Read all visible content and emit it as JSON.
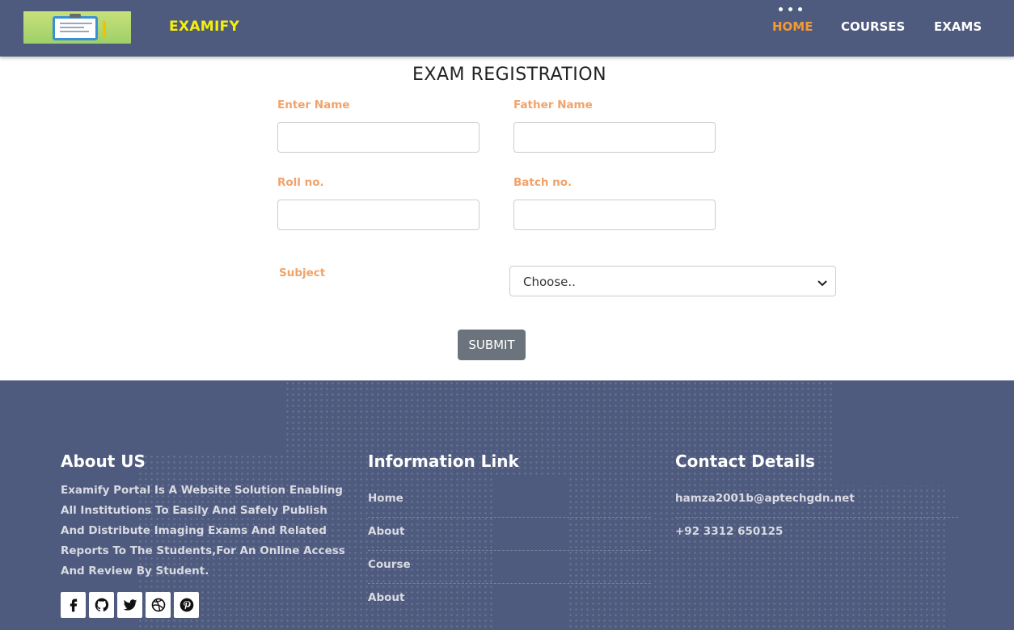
{
  "navbar": {
    "brand": "EXAMIFY",
    "links": [
      {
        "label": "HOME",
        "active": true
      },
      {
        "label": "COURSES",
        "active": false
      },
      {
        "label": "EXAMS",
        "active": false
      }
    ]
  },
  "form": {
    "title": "EXAM REGISTRATION",
    "name_label": "Enter Name",
    "name_value": "",
    "father_label": "Father Name",
    "father_value": "",
    "roll_label": "Roll no.",
    "roll_value": "",
    "batch_label": "Batch no.",
    "batch_value": "",
    "subject_label": "Subject",
    "subject_selected": "Choose..",
    "submit_label": "SUBMIT"
  },
  "footer": {
    "about_heading": "About US",
    "about_text": "Examify Portal Is A Website Solution Enabling All Institutions To Easily And Safely Publish And Distribute Imaging Exams And Related Reports To The Students,For An Online Access And Review By Student.",
    "social_icons": [
      "facebook-icon",
      "github-icon",
      "twitter-icon",
      "dribbble-icon",
      "pinterest-icon"
    ],
    "info_heading": "Information Link",
    "info_links": [
      "Home",
      "About",
      "Course",
      "About"
    ],
    "contact_heading": "Contact Details",
    "contact_email": "hamza2001b@aptechgdn.net",
    "contact_phone": "+92 3312 650125"
  },
  "colors": {
    "navbar_bg": "#4e5a7e",
    "brand": "#f5f00a",
    "active_link": "#f39a33",
    "label": "#f0a36a",
    "submit_bg": "#6b747c"
  }
}
